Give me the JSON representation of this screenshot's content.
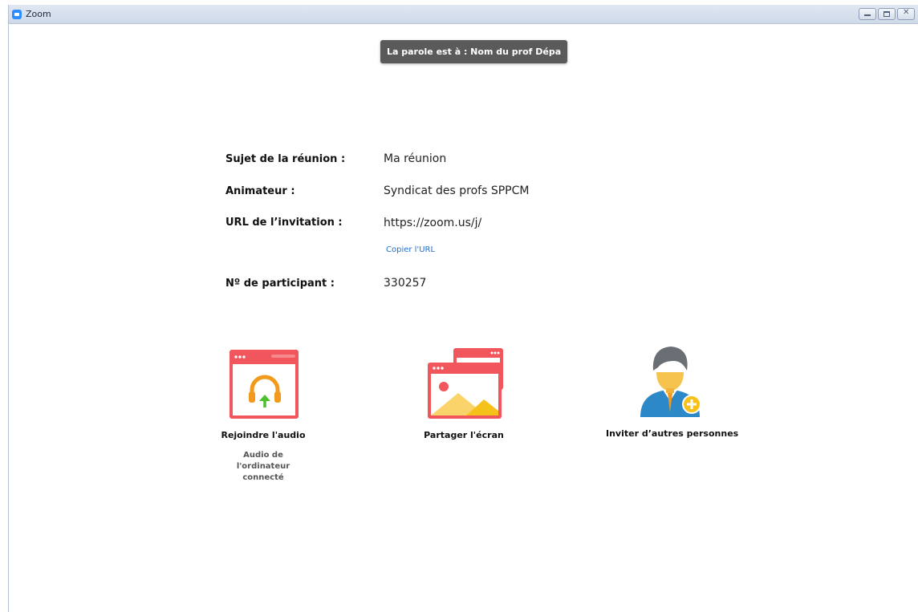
{
  "window": {
    "title": "Zoom"
  },
  "speaker": {
    "text": "La parole est à : Nom du prof Dépa"
  },
  "meeting": {
    "topic_label": "Sujet de la réunion :",
    "topic_value": "Ma réunion",
    "host_label": "Animateur :",
    "host_value": "Syndicat des profs SPPCM",
    "url_label": "URL de l’invitation :",
    "url_value": "https://zoom.us/j/",
    "copy_url": "Copier l'URL",
    "participant_label": "Nº de participant :",
    "participant_value": "330257"
  },
  "actions": {
    "join_audio": {
      "label": "Rejoindre l'audio",
      "sub_line1": "Audio de l'ordinateur",
      "sub_line2": "connecté",
      "icon": "headphones-window-icon"
    },
    "share_screen": {
      "label": "Partager l'écran",
      "icon": "share-screen-icon"
    },
    "invite": {
      "label": "Inviter d’autres personnes",
      "icon": "invite-person-icon"
    }
  },
  "colors": {
    "window_red": "#f0565b",
    "headphone_orange": "#f19a1b",
    "arrow_green": "#4cbf2c",
    "person_blue": "#2d88c8",
    "link_blue": "#1f6fd1"
  }
}
